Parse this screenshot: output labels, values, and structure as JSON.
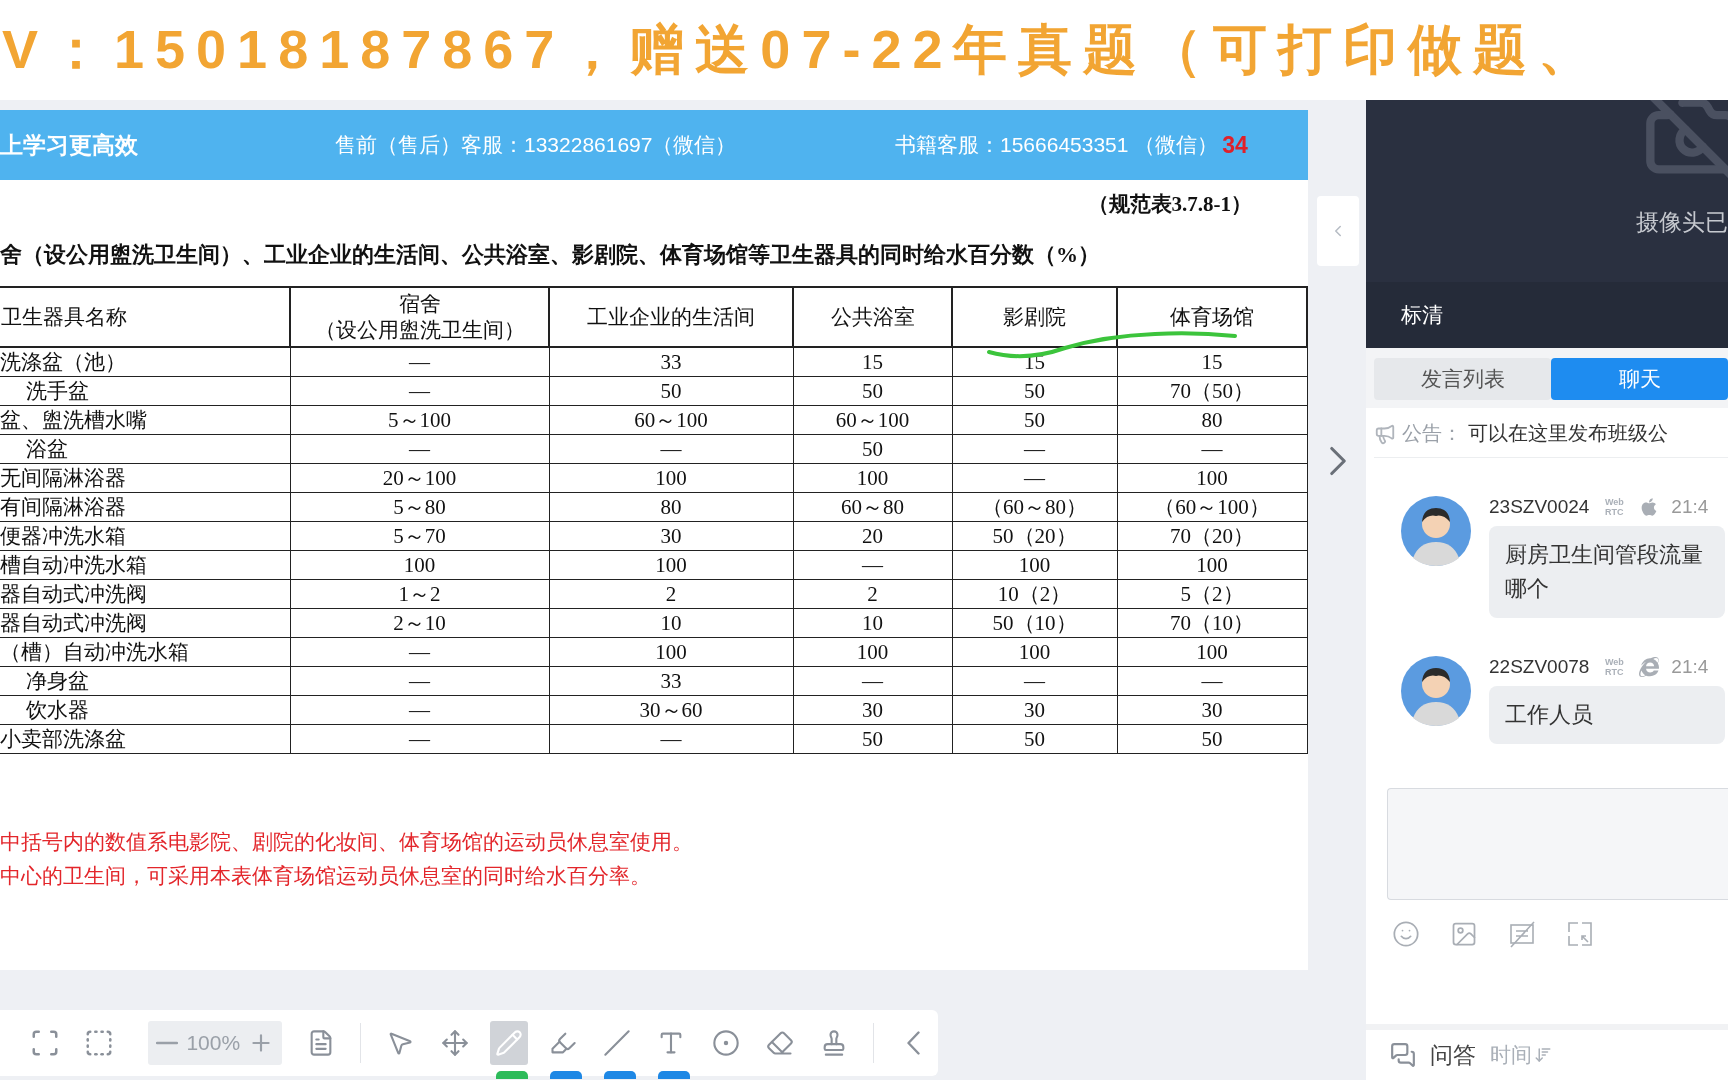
{
  "overlay_banner": "V：15018187867，赠送07-22年真题（可打印做题、",
  "slide": {
    "header": {
      "left": "上学习更高效",
      "center": "售前（售后）客服：13322861697（微信）",
      "right": "书籍客服：15666453351 （微信）",
      "page": "34"
    },
    "table_ref": "（规范表3.7.8-1）",
    "table_title": "舍（设公用盥洗卫生间）、工业企业的生活间、公共浴室、影剧院、体育场馆等卫生器具的同时给水百分数（%）",
    "table": {
      "columns": [
        {
          "lines": [
            "卫生器具名称"
          ]
        },
        {
          "lines": [
            "宿舍",
            "（设公用盥洗卫生间）"
          ]
        },
        {
          "lines": [
            "工业企业的生活间"
          ]
        },
        {
          "lines": [
            "公共浴室"
          ]
        },
        {
          "lines": [
            "影剧院"
          ]
        },
        {
          "lines": [
            "体育场馆"
          ]
        }
      ],
      "rows": [
        {
          "indent": false,
          "cells": [
            "洗涤盆（池）",
            "—",
            "33",
            "15",
            "15",
            "15"
          ]
        },
        {
          "indent": true,
          "cells": [
            "洗手盆",
            "—",
            "50",
            "50",
            "50",
            "70（50）"
          ]
        },
        {
          "indent": false,
          "cells": [
            "盆、盥洗槽水嘴",
            "5～100",
            "60～100",
            "60～100",
            "50",
            "80"
          ]
        },
        {
          "indent": true,
          "cells": [
            "浴盆",
            "—",
            "—",
            "50",
            "—",
            "—"
          ]
        },
        {
          "indent": false,
          "cells": [
            "无间隔淋浴器",
            "20～100",
            "100",
            "100",
            "—",
            "100"
          ]
        },
        {
          "indent": false,
          "cells": [
            "有间隔淋浴器",
            "5～80",
            "80",
            "60～80",
            "（60～80）",
            "（60～100）"
          ]
        },
        {
          "indent": false,
          "cells": [
            "便器冲洗水箱",
            "5～70",
            "30",
            "20",
            "50（20）",
            "70（20）"
          ]
        },
        {
          "indent": false,
          "cells": [
            "槽自动冲洗水箱",
            "100",
            "100",
            "—",
            "100",
            "100"
          ]
        },
        {
          "indent": false,
          "cells": [
            "器自动式冲洗阀",
            "1～2",
            "2",
            "2",
            "10（2）",
            "5（2）"
          ]
        },
        {
          "indent": false,
          "cells": [
            "器自动式冲洗阀",
            "2～10",
            "10",
            "10",
            "50（10）",
            "70（10）"
          ]
        },
        {
          "indent": false,
          "cells": [
            "（槽）自动冲洗水箱",
            "—",
            "100",
            "100",
            "100",
            "100"
          ]
        },
        {
          "indent": true,
          "cells": [
            "净身盆",
            "—",
            "33",
            "—",
            "—",
            "—"
          ]
        },
        {
          "indent": true,
          "cells": [
            "饮水器",
            "—",
            "30～60",
            "30",
            "30",
            "30"
          ]
        },
        {
          "indent": false,
          "cells": [
            "小卖部洗涤盆",
            "—",
            "—",
            "50",
            "50",
            "50"
          ]
        }
      ]
    },
    "notes": [
      "中括号内的数值系电影院、剧院的化妆间、体育场馆的运动员休息室使用。",
      "中心的卫生间，可采用本表体育场馆运动员休息室的同时给水百分率。"
    ]
  },
  "toolbar": {
    "view": [
      {
        "kind": "fit"
      },
      {
        "kind": "fullscreen"
      }
    ],
    "zoom": {
      "value": "100%"
    },
    "draw": [
      {
        "kind": "clear",
        "selected": false
      },
      {
        "kind": "laser",
        "selected": false
      },
      {
        "kind": "move",
        "selected": false
      },
      {
        "kind": "pen",
        "selected": true,
        "color": "#2dbb5a"
      },
      {
        "kind": "highlighter",
        "selected": false,
        "color": "#1e88e5"
      },
      {
        "kind": "line",
        "selected": false,
        "color": "#1e88e5"
      },
      {
        "kind": "text",
        "selected": false,
        "color": "#1e88e5"
      },
      {
        "kind": "target",
        "selected": false
      },
      {
        "kind": "eraser",
        "selected": false
      },
      {
        "kind": "brush",
        "selected": false
      }
    ]
  },
  "camera": {
    "status": "摄像头已",
    "quality": "标清"
  },
  "tabs": [
    {
      "label": "发言列表",
      "selected": false
    },
    {
      "label": "聊天",
      "selected": true
    }
  ],
  "announcement": {
    "label": "公告：",
    "text": "可以在这里发布班级公"
  },
  "messages": [
    {
      "user": "23SZV0024",
      "badge": "Web RTC",
      "kind": "apple",
      "time": "21:4",
      "lines": [
        "厨房卫生间管段流量",
        "哪个"
      ]
    },
    {
      "user": "22SZV0078",
      "badge": "Web RTC",
      "kind": "ie",
      "time": "21:4",
      "lines": [
        "工作人员"
      ]
    }
  ],
  "bottom": {
    "tab": "问答",
    "sort": "时间"
  }
}
